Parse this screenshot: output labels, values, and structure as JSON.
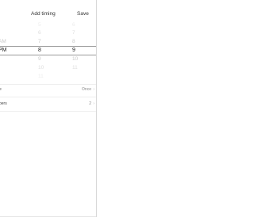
{
  "header": {
    "title": "Add timing",
    "save_label": "Save"
  },
  "picker": {
    "rows": [
      {
        "ampm": "",
        "hour": "5",
        "minute": "6",
        "style": "faint"
      },
      {
        "ampm": "",
        "hour": "6",
        "minute": "7",
        "style": "light"
      },
      {
        "ampm": "AM",
        "hour": "7",
        "minute": "8",
        "style": "mid"
      },
      {
        "ampm": "PM",
        "hour": "8",
        "minute": "9",
        "style": "selected"
      },
      {
        "ampm": "",
        "hour": "9",
        "minute": "10",
        "style": "mid"
      },
      {
        "ampm": "",
        "hour": "10",
        "minute": "11",
        "style": "light"
      },
      {
        "ampm": "",
        "hour": "11",
        "minute": "",
        "style": "faint"
      }
    ]
  },
  "settings": {
    "repeat": {
      "label": "e",
      "value": "Once",
      "chevron": "›"
    },
    "numbers": {
      "label": "bers",
      "value": "2",
      "chevron": "›"
    }
  },
  "colors": {
    "selected_text": "#222222",
    "mid_text": "#c9c9c9",
    "light_text": "#dddddd",
    "faint_text": "#ececec"
  }
}
